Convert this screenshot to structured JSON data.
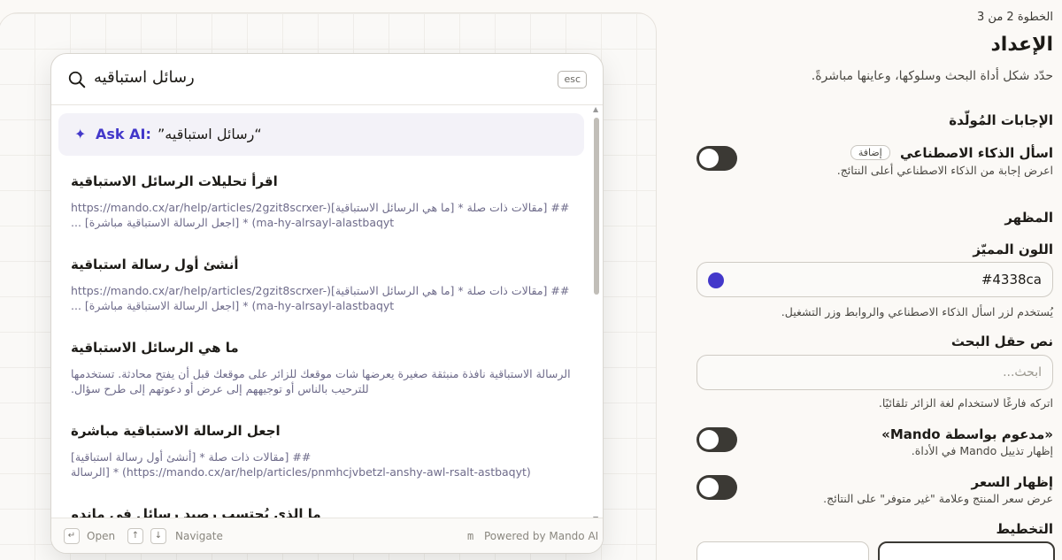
{
  "preview": {
    "search": {
      "query": "رسائل استباقيه",
      "esc_label": "esc"
    },
    "ask_ai": {
      "label": "Ask AI:",
      "query": "“رسائل استباقيه”"
    },
    "results": [
      {
        "title": "اقرأ تحليلات الرسائل الاستباقية",
        "snippet": "## [مقالات ذات صلة * [ما هي الرسائل الاستباقية](https://mando.cx/ar/help/articles/2gzit8scrxer-ma-hy-alrsayl-alastbaqyt) * [اجعل الرسالة الاستباقية مباشرة] ..."
      },
      {
        "title": "أنشئ أول رسالة استباقية",
        "snippet": "## [مقالات ذات صلة * [ما هي الرسائل الاستباقية](https://mando.cx/ar/help/articles/2gzit8scrxer-ma-hy-alrsayl-alastbaqyt) * [اجعل الرسالة الاستباقية مباشرة] ..."
      },
      {
        "title": "ما هي الرسائل الاستباقية",
        "snippet": "الرسالة الاستباقية نافذة منبثقة صغيرة يعرضها شات موقعك للزائر على موقعك قبل أن يفتح محادثة. تستخدمها للترحيب بالناس أو توجيههم إلى عرض أو دعوتهم إلى طرح سؤال."
      },
      {
        "title": "اجعل الرسالة الاستباقية مباشرة",
        "snippet": "## [مقالات ذات صلة * [أنشئ أول رسالة استباقية](https://mando.cx/ar/help/articles/pnmhcjvbetzl-anshy-awl-rsalt-astbaqyt) * [الرسالة الاستباقية لا تظهر للزوار] ..."
      },
      {
        "title": "ما الذي يُحتسب رصيد رسائل في ماندو",
        "snippet": ""
      }
    ],
    "footer": {
      "open_label": "Open",
      "navigate_label": "Navigate",
      "powered_label": "Powered by Mando AI",
      "enter_key": "↵",
      "up_key": "↑",
      "down_key": "↓",
      "brand_glyph": "m"
    }
  },
  "panel": {
    "step": "الخطوة 2 من 3",
    "title": "الإعداد",
    "subtitle": "حدّد شكل أداة البحث وسلوكها، وعاينها مباشرةً.",
    "generated_section": "الإجابات المُولّدة",
    "ask_ai_toggle": {
      "label": "اسأل الذكاء الاصطناعي",
      "badge": "إضافة",
      "hint": "اعرض إجابة من الذكاء الاصطناعي أعلى النتائج.",
      "on": false
    },
    "appearance_section": "المظهر",
    "accent": {
      "label": "اللون المميّز",
      "value": "#4338ca",
      "hint": "يُستخدم لزر اسأل الذكاء الاصطناعي والروابط وزر التشغيل."
    },
    "search_text": {
      "label": "نص حقل البحث",
      "placeholder": "ابحث...",
      "hint": "اتركه فارغًا لاستخدام لغة الزائر تلقائيًا."
    },
    "powered_toggle": {
      "label": "«مدعوم بواسطة Mando»",
      "hint": "إظهار تذييل Mando في الأداة.",
      "on": false
    },
    "price_toggle": {
      "label": "إظهار السعر",
      "hint": "عرض سعر المنتج وعلامة \"غير متوفر\" على النتائج.",
      "on": false
    },
    "layout_section": "التخطيط"
  }
}
